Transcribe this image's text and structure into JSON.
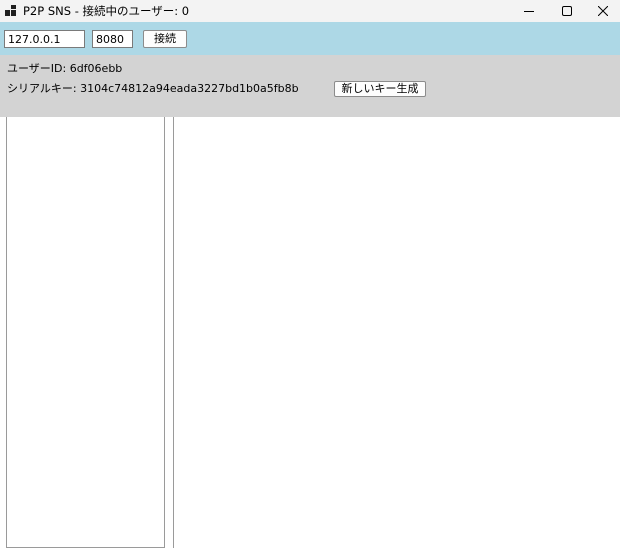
{
  "window": {
    "title": "P2P SNS - 接続中のユーザー: 0",
    "controls": [
      "minimize-icon",
      "maximize-icon",
      "close-icon"
    ]
  },
  "toolbar": {
    "host_value": "127.0.0.1",
    "port_value": "8080",
    "connect_label": "接続",
    "background_color": "#add8e6"
  },
  "info": {
    "user_id_text": "ユーザーID: 6df06ebb",
    "serial_key_text": "シリアルキー: 3104c74812a94eada3227bd1b0a5fb8b",
    "generate_key_label": "新しいキー生成",
    "background_color": "#d3d3d3"
  }
}
